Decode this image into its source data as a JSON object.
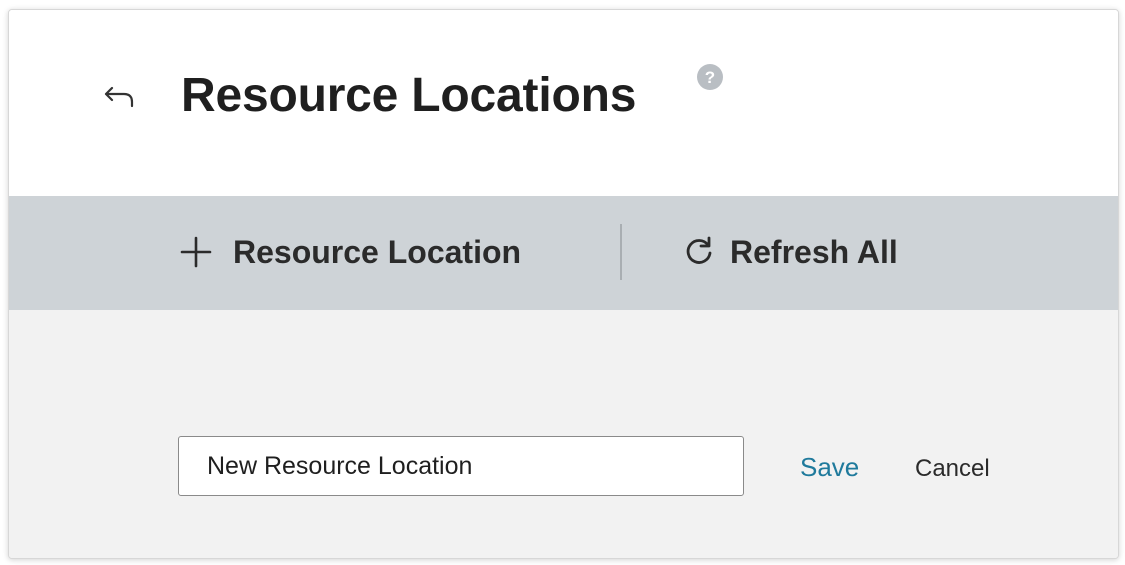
{
  "header": {
    "title": "Resource Locations",
    "back_icon": "back-arrow-icon",
    "help_icon": "help-question-icon"
  },
  "toolbar": {
    "add_label": "Resource Location",
    "add_icon": "plus-icon",
    "refresh_label": "Refresh All",
    "refresh_icon": "refresh-icon"
  },
  "form": {
    "name_value": "New Resource Location",
    "save_label": "Save",
    "cancel_label": "Cancel"
  },
  "colors": {
    "toolbar_bg": "#ced3d7",
    "content_bg": "#f2f2f2",
    "link_accent": "#1f7a9c",
    "help_icon": "#b9bec3"
  }
}
